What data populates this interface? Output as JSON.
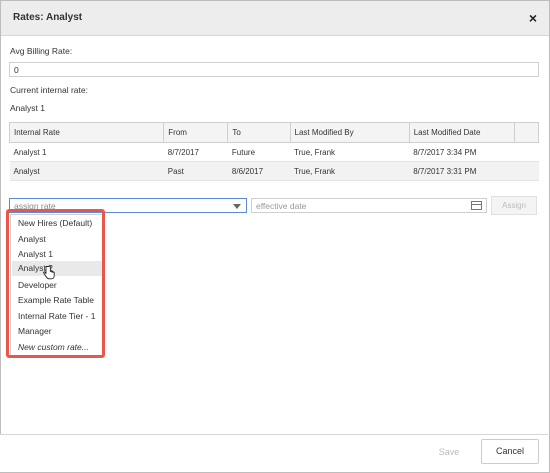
{
  "dialog": {
    "title": "Rates: Analyst",
    "close_icon": "×"
  },
  "avg_billing": {
    "label": "Avg Billing Rate:",
    "value": "0"
  },
  "current_internal": {
    "label": "Current internal rate:",
    "value": "Analyst 1"
  },
  "table": {
    "headers": [
      "Internal Rate",
      "From",
      "To",
      "Last Modified By",
      "Last Modified Date"
    ],
    "rows": [
      [
        "Analyst 1",
        "8/7/2017",
        "Future",
        "True, Frank",
        "8/7/2017 3:34 PM"
      ],
      [
        "Analyst",
        "Past",
        "8/6/2017",
        "True, Frank",
        "8/7/2017 3:31 PM"
      ]
    ]
  },
  "assign": {
    "placeholder": "assign rate",
    "date_placeholder": "effective date",
    "button_label": "Assign",
    "options": [
      "New Hires (Default)",
      "Analyst",
      "Analyst 1",
      "Analyst 2",
      "Developer",
      "Example Rate Table",
      "Internal Rate Tier - 1",
      "Manager",
      "New custom rate..."
    ],
    "hovered_option": "Analyst 2"
  },
  "footer": {
    "save_label": "Save",
    "cancel_label": "Cancel"
  }
}
